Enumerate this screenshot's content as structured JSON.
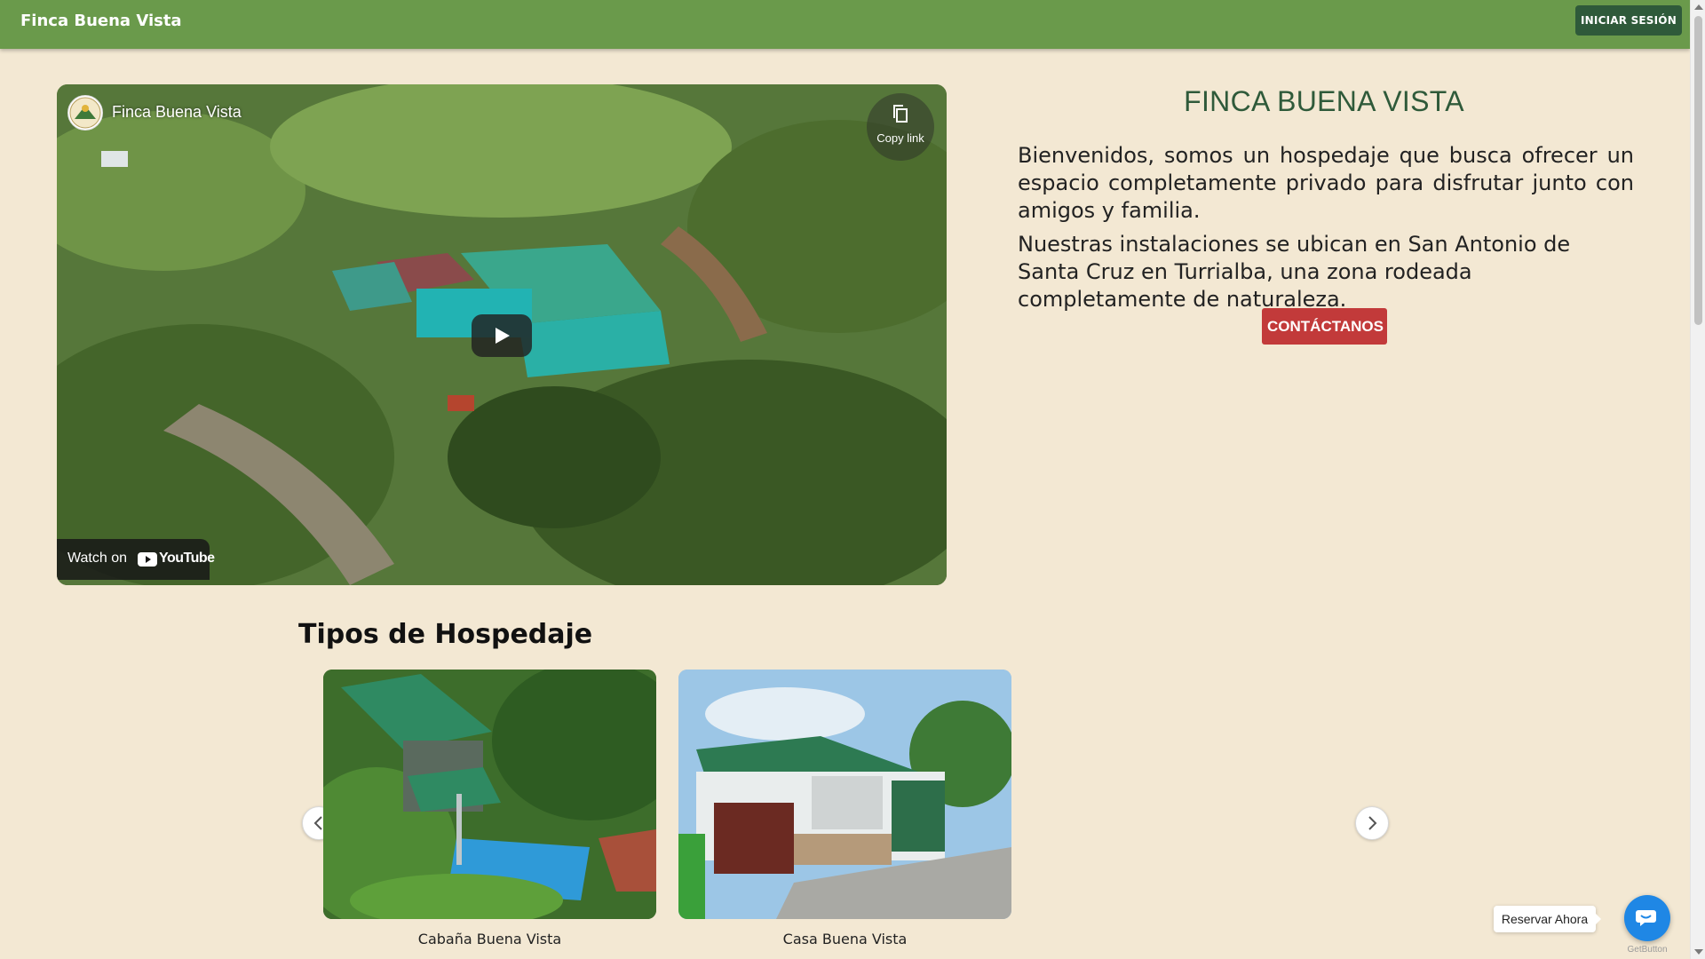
{
  "navbar": {
    "brand": "Finca Buena Vista",
    "login_label": "INICIAR SESIÓN"
  },
  "video": {
    "channel_title": "Finca Buena Vista",
    "copy_link_label": "Copy link",
    "watch_on_label": "Watch on",
    "youtube_label": "YouTube"
  },
  "intro": {
    "heading": "FINCA BUENA VISTA",
    "paragraph1": "Bienvenidos, somos un hospedaje que busca ofrecer un espacio completamente privado para disfrutar junto con amigos y familia.",
    "paragraph2": "Nuestras instalaciones se ubican en San Antonio de Santa Cruz en Turrialba, una zona rodeada completamente de naturaleza.",
    "contact_label": "CONTÁCTANOS"
  },
  "lodging": {
    "title": "Tipos de Hospedaje",
    "cards": [
      {
        "caption": "Cabaña Buena Vista"
      },
      {
        "caption": "Casa Buena Vista"
      }
    ]
  },
  "chat_widget": {
    "reserve_label": "Reservar Ahora",
    "powered_by": "GetButton"
  },
  "colors": {
    "navbar": "#6a9a4b",
    "login_button": "#2f5a3a",
    "page_background": "#f3e8d3",
    "heading": "#2f5a3a",
    "contact_button": "#c23a3a",
    "chat_button": "#1f87e5"
  }
}
